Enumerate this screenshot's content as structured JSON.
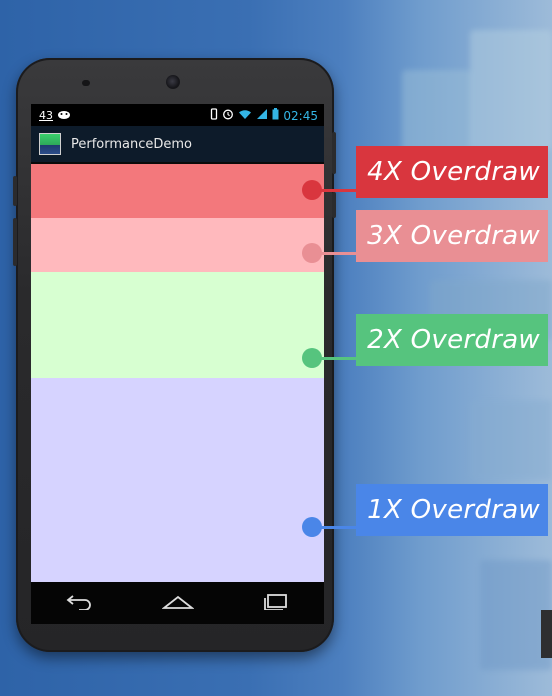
{
  "status_bar": {
    "left_number": "43",
    "time": "02:45"
  },
  "app": {
    "title": "PerformanceDemo"
  },
  "overdraw_legend": [
    {
      "label": "4X Overdraw",
      "color": "#d9363e",
      "band_color": "#f3787c"
    },
    {
      "label": "3X Overdraw",
      "color": "#e98f94",
      "band_color": "#ffb9bd"
    },
    {
      "label": "2X Overdraw",
      "color": "#56c47e",
      "band_color": "#d7ffd1"
    },
    {
      "label": "1X Overdraw",
      "color": "#4a86e8",
      "band_color": "#d6d3ff"
    }
  ],
  "icons": {
    "status_left": [
      "notification-number",
      "android-robot-icon"
    ],
    "status_right": [
      "vibrate-icon",
      "alarm-icon",
      "wifi-icon",
      "signal-icon",
      "battery-icon"
    ],
    "nav": [
      "back-icon",
      "home-icon",
      "recents-icon"
    ]
  }
}
